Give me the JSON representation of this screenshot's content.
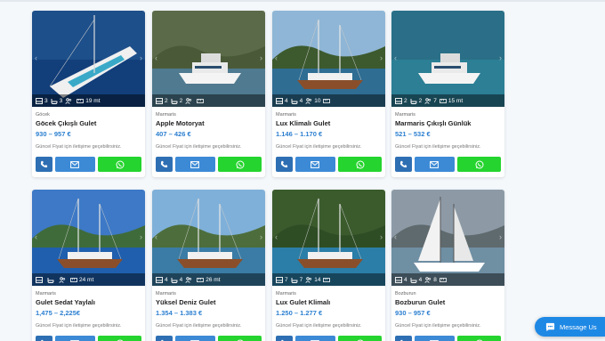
{
  "colors": {
    "price": "#2b7fd0",
    "phone_button": "#2e6fb3",
    "mail_button": "#3c8ad6",
    "whatsapp_button": "#25d42e",
    "chat_button": "#1e88e5"
  },
  "cards": [
    {
      "location": "Göcek",
      "name": "Göcek Çıkışlı Gulet",
      "price": "930 – 957 €",
      "note": "Güncel Fiyat için iletişime geçebilirsiniz.",
      "features": {
        "cabins": "3",
        "bathrooms": "3",
        "guests": "",
        "length": "19 mt"
      }
    },
    {
      "location": "Marmaris",
      "name": "Apple Motoryat",
      "price": "407 – 426 €",
      "note": "Güncel Fiyat için iletişime geçebilirsiniz.",
      "features": {
        "cabins": "2",
        "bathrooms": "2",
        "guests": "",
        "length": ""
      }
    },
    {
      "location": "Marmaris",
      "name": "Lux Klimalı Gulet",
      "price": "1.146 – 1.170 €",
      "note": "Güncel Fiyat için iletişime geçebilirsiniz.",
      "features": {
        "cabins": "4",
        "bathrooms": "4",
        "guests": "10",
        "length": ""
      }
    },
    {
      "location": "Marmaris",
      "name": "Marmaris Çıkışlı Günlük",
      "price": "521 – 532 €",
      "note": "Güncel Fiyat için iletişime geçebilirsiniz.",
      "features": {
        "cabins": "2",
        "bathrooms": "2",
        "guests": "7",
        "length": "15 mt"
      }
    },
    {
      "location": "Marmaris",
      "name": "Gulet Sedat Yaylalı",
      "price": "1,475 – 2,225€",
      "note": "Güncel Fiyat için iletişime geçebilirsiniz.",
      "features": {
        "cabins": "",
        "bathrooms": "",
        "guests": "",
        "length": "24 mt"
      }
    },
    {
      "location": "Marmaris",
      "name": "Yüksel Deniz Gulet",
      "price": "1.354 – 1.383 €",
      "note": "Güncel Fiyat için iletişime geçebilirsiniz.",
      "features": {
        "cabins": "4",
        "bathrooms": "4",
        "guests": "",
        "length": "26 mt"
      }
    },
    {
      "location": "Marmaris",
      "name": "Lux Gulet Klimalı",
      "price": "1.250 – 1.277 €",
      "note": "Güncel Fiyat için iletişime geçebilirsiniz.",
      "features": {
        "cabins": "7",
        "bathrooms": "7",
        "guests": "14",
        "length": ""
      }
    },
    {
      "location": "Bozburun",
      "name": "Bozburun Gulet",
      "price": "930 – 957 €",
      "note": "Güncel Fiyat için iletişime geçebilirsiniz.",
      "features": {
        "cabins": "4",
        "bathrooms": "4",
        "guests": "8",
        "length": ""
      }
    }
  ],
  "chat": {
    "label": "Message Us"
  },
  "icons": {
    "phone": "phone-icon",
    "mail": "mail-icon",
    "whatsapp": "whatsapp-icon",
    "cabins": "bed-icon",
    "bathrooms": "bathtub-icon",
    "guests": "guests-icon",
    "length": "ruler-icon",
    "chat": "chat-bubble-icon"
  }
}
